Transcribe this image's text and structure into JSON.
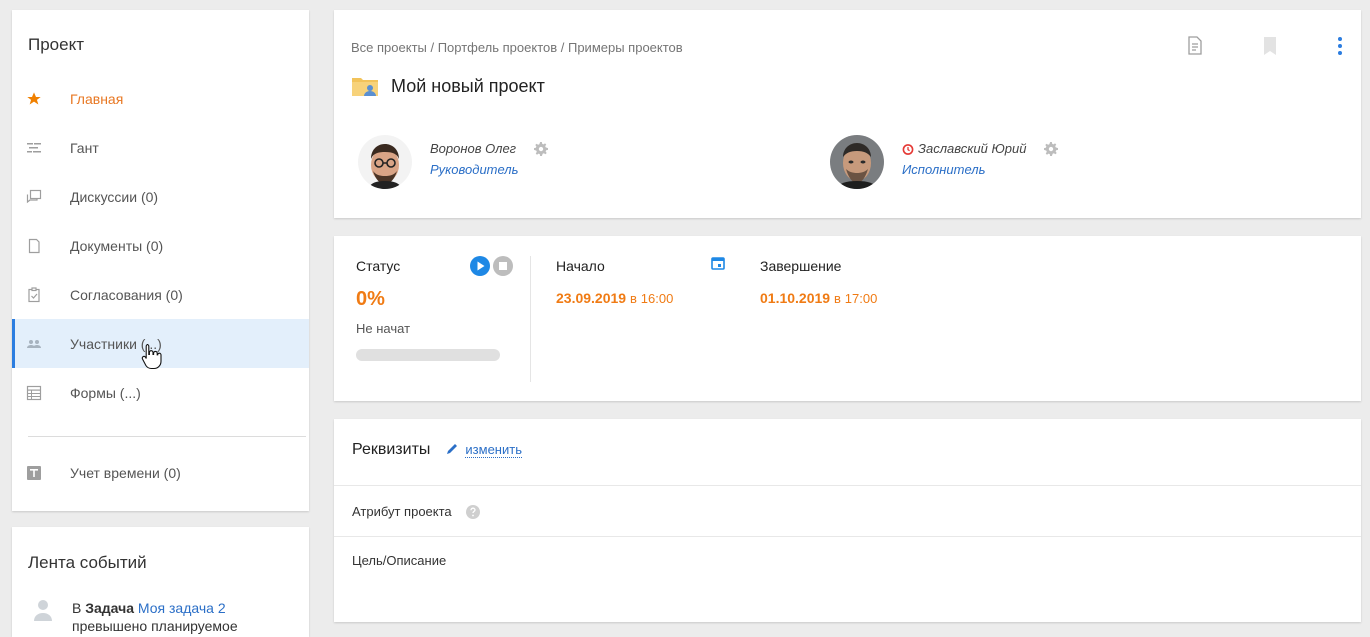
{
  "sidebar": {
    "title": "Проект",
    "items": [
      {
        "label": "Главная",
        "icon": "star-icon"
      },
      {
        "label": "Гант",
        "icon": "gantt-icon"
      },
      {
        "label": "Дискуссии (0)",
        "icon": "discussion-icon"
      },
      {
        "label": "Документы (0)",
        "icon": "document-icon"
      },
      {
        "label": "Согласования (0)",
        "icon": "approval-icon"
      },
      {
        "label": "Участники (...)",
        "icon": "members-icon"
      },
      {
        "label": "Формы (...)",
        "icon": "forms-icon"
      }
    ],
    "time_item": {
      "label": "Учет времени (0)",
      "icon": "time-tracking-icon"
    }
  },
  "events": {
    "title": "Лента событий",
    "item": {
      "prefix": "В",
      "type": "Задача",
      "link": "Моя задача 2",
      "rest": "превышено планируемое"
    }
  },
  "header": {
    "breadcrumb": "Все проекты / Портфель проектов / Примеры проектов",
    "project_title": "Мой новый проект",
    "manager": {
      "name": "Воронов Олег",
      "role": "Руководитель"
    },
    "executor": {
      "name": "Заславский Юрий",
      "role": "Исполнитель"
    }
  },
  "status": {
    "label": "Статус",
    "percent": "0%",
    "progress": 0,
    "state": "Не начат",
    "start": {
      "label": "Начало",
      "date": "23.09.2019",
      "sep": "в",
      "time": "16:00"
    },
    "end": {
      "label": "Завершение",
      "date": "01.10.2019",
      "sep": "в",
      "time": "17:00"
    }
  },
  "requisites": {
    "title": "Реквизиты",
    "edit_label": "изменить",
    "rows": [
      "Атрибут проекта",
      "Цель/Описание"
    ]
  },
  "colors": {
    "accent_orange": "#f07b14",
    "link_blue": "#2b6fc7",
    "active_bg": "#e3effb",
    "play_blue": "#1e88e5"
  }
}
